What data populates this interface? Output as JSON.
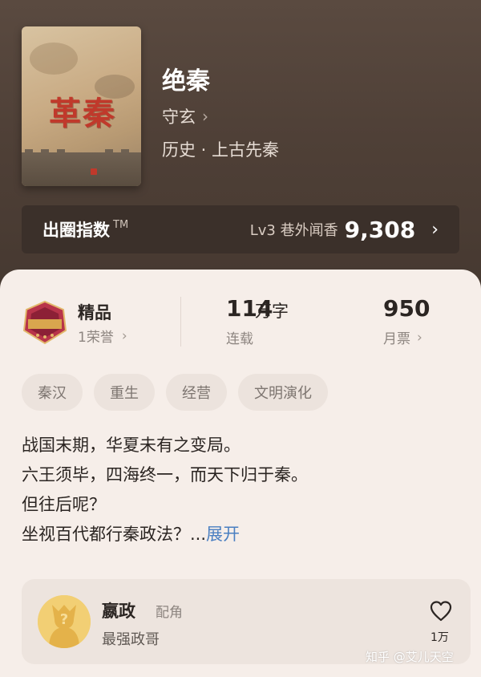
{
  "book": {
    "title": "绝秦",
    "author": "守玄",
    "genre": "历史 · 上古先秦",
    "cover_title": "革秦"
  },
  "index": {
    "label": "出圈指数",
    "tm": "TM",
    "level": "Lv3 巷外闻香",
    "score": "9,308"
  },
  "stats": {
    "quality": {
      "title": "精品",
      "sub": "1荣誉"
    },
    "words": {
      "value": "114",
      "unit": "万字",
      "status": "连载"
    },
    "tickets": {
      "value": "950",
      "label": "月票"
    }
  },
  "tags": [
    "秦汉",
    "重生",
    "经营",
    "文明演化"
  ],
  "description": {
    "lines": [
      "战国末期，华夏未有之变局。",
      "六王须毕，四海终一，而天下归于秦。",
      "但往后呢？",
      "坐视百代都行秦政法？..."
    ],
    "more": "展开"
  },
  "role": {
    "name": "嬴政",
    "type": "配角",
    "desc": "最强政哥",
    "likes": "1万"
  },
  "watermark": "知乎 @艾儿天空",
  "colors": {
    "accent": "#4a7fc1",
    "hero_bg": "#4f4037",
    "card_bg": "#f6eee9"
  }
}
